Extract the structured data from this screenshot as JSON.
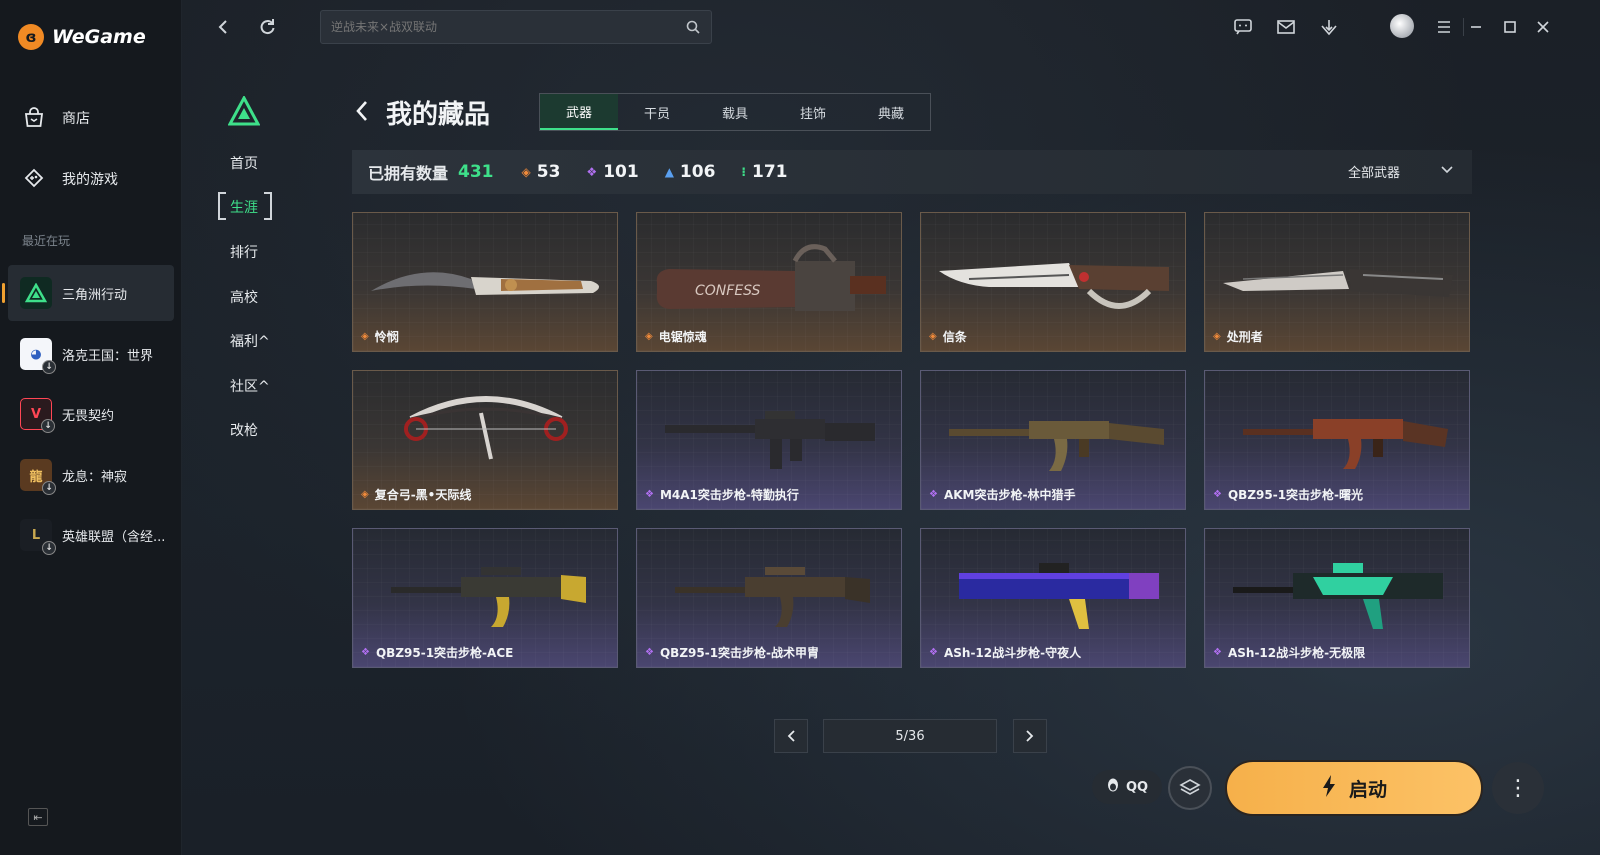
{
  "app": {
    "name": "WeGame"
  },
  "sidebar": {
    "nav": [
      {
        "label": "商店",
        "icon": "shop-bag-icon"
      },
      {
        "label": "我的游戏",
        "icon": "gamepad-icon"
      }
    ],
    "recent_title": "最近在玩",
    "games": [
      {
        "name": "三角洲行动",
        "active": true
      },
      {
        "name": "洛克王国：世界",
        "active": false
      },
      {
        "name": "无畏契约",
        "active": false
      },
      {
        "name": "龙息：神寂",
        "active": false
      },
      {
        "name": "英雄联盟（含经...",
        "active": false
      }
    ]
  },
  "topbar": {
    "search_placeholder": "逆战未来×战双联动"
  },
  "game_nav": {
    "items": [
      {
        "label": "首页"
      },
      {
        "label": "生涯",
        "active": true
      },
      {
        "label": "排行"
      },
      {
        "label": "高校"
      },
      {
        "label": "福利^"
      },
      {
        "label": "社区^"
      },
      {
        "label": "改枪"
      }
    ]
  },
  "header": {
    "title": "我的藏品",
    "tabs": [
      {
        "label": "武器",
        "active": true
      },
      {
        "label": "干员"
      },
      {
        "label": "载具"
      },
      {
        "label": "挂饰"
      },
      {
        "label": "典藏"
      }
    ]
  },
  "stats": {
    "label": "已拥有数量",
    "total": "431",
    "counts": [
      {
        "value": "53",
        "color": "#f08a3a"
      },
      {
        "value": "101",
        "color": "#b070f0"
      },
      {
        "value": "106",
        "color": "#5aa0f0"
      },
      {
        "value": "171",
        "color": "#3ee08a"
      }
    ],
    "filter_label": "全部武器"
  },
  "items": [
    {
      "name": "怜悯",
      "rarity": "orange",
      "art": "knife"
    },
    {
      "name": "电锯惊魂",
      "rarity": "orange",
      "art": "chainsaw"
    },
    {
      "name": "信条",
      "rarity": "orange",
      "art": "knife2"
    },
    {
      "name": "处刑者",
      "rarity": "orange",
      "art": "knife3"
    },
    {
      "name": "复合弓-黑•天际线",
      "rarity": "orange",
      "art": "bow"
    },
    {
      "name": "M4A1突击步枪-特勤执行",
      "rarity": "purple",
      "art": "rifle-black"
    },
    {
      "name": "AKM突击步枪-林中猎手",
      "rarity": "purple",
      "art": "rifle-camo"
    },
    {
      "name": "QBZ95-1突击步枪-曙光",
      "rarity": "purple",
      "art": "rifle-red"
    },
    {
      "name": "QBZ95-1突击步枪-ACE",
      "rarity": "purple",
      "art": "rifle-yellow"
    },
    {
      "name": "QBZ95-1突击步枪-战术甲胄",
      "rarity": "purple",
      "art": "rifle-brown"
    },
    {
      "name": "ASh-12战斗步枪-守夜人",
      "rarity": "purple",
      "art": "rifle-blue"
    },
    {
      "name": "ASh-12战斗步枪-无极限",
      "rarity": "purple",
      "art": "rifle-teal"
    }
  ],
  "pagination": {
    "current": "5/36"
  },
  "footer": {
    "qq_label": "QQ",
    "launch_label": "启动"
  }
}
